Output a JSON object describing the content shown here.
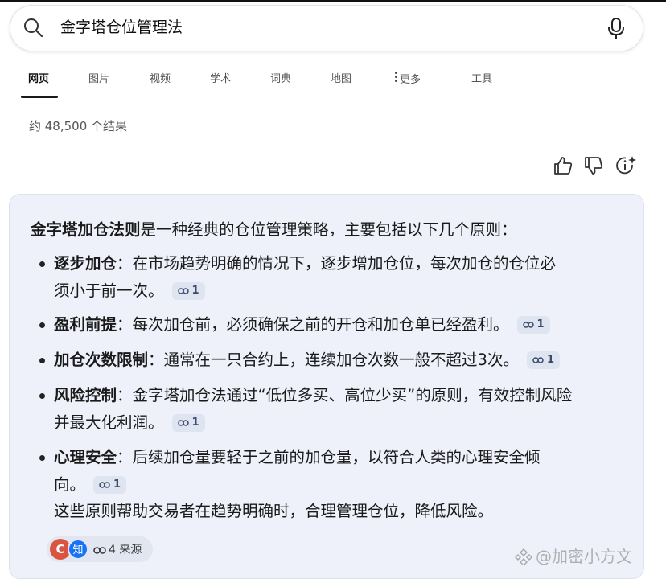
{
  "search": {
    "query": "金字塔仓位管理法"
  },
  "tabs": [
    {
      "label": "网页"
    },
    {
      "label": "图片"
    },
    {
      "label": "视频"
    },
    {
      "label": "学术"
    },
    {
      "label": "词典"
    },
    {
      "label": "地图"
    },
    {
      "label": "更多"
    },
    {
      "label": "工具"
    }
  ],
  "results": {
    "count_text": "约 48,500 个结果"
  },
  "answer": {
    "intro_bold": "金字塔加仓法则",
    "intro_rest": "是一种经典的仓位管理策略，主要包括以下几个原则：",
    "bullets": [
      {
        "title": "逐步加仓",
        "sep": "：",
        "line1": "在市场趋势明确的情况下，逐步增加仓位，每次加仓的仓位必",
        "line2": "须小于前一次。",
        "cite": "1"
      },
      {
        "title": "盈利前提",
        "sep": "：",
        "line1": "每次加仓前，必须确保之前的开仓和加仓单已经盈利。",
        "line2": "",
        "cite": "1"
      },
      {
        "title": "加仓次数限制",
        "sep": "：",
        "line1": "通常在一只合约上，连续加仓次数一般不超过3次。",
        "line2": "",
        "cite": "1"
      },
      {
        "title": "风险控制",
        "sep": "：",
        "line1": "金字塔加仓法通过“低位多买、高位少买”的原则，有效控制风险",
        "line2": "并最大化利润。",
        "cite": "1"
      },
      {
        "title": "心理安全",
        "sep": "：",
        "line1": "后续加仓量要轻于之前的加仓量，以符合人类的心理安全倾",
        "line2": "向。",
        "cite": "1"
      }
    ],
    "summary": "这些原则帮助交易者在趋势明确时，合理管理仓位，降低风险。",
    "sources": {
      "icon_c": "C",
      "icon_zhi": "知",
      "label": "4 来源"
    }
  },
  "watermark": "@加密小方文",
  "colors": {
    "card_bg": "#eef1f9",
    "cite_bg": "#dfe4f1",
    "zhihu_blue": "#1772f6",
    "c_red": "#d9553f"
  }
}
